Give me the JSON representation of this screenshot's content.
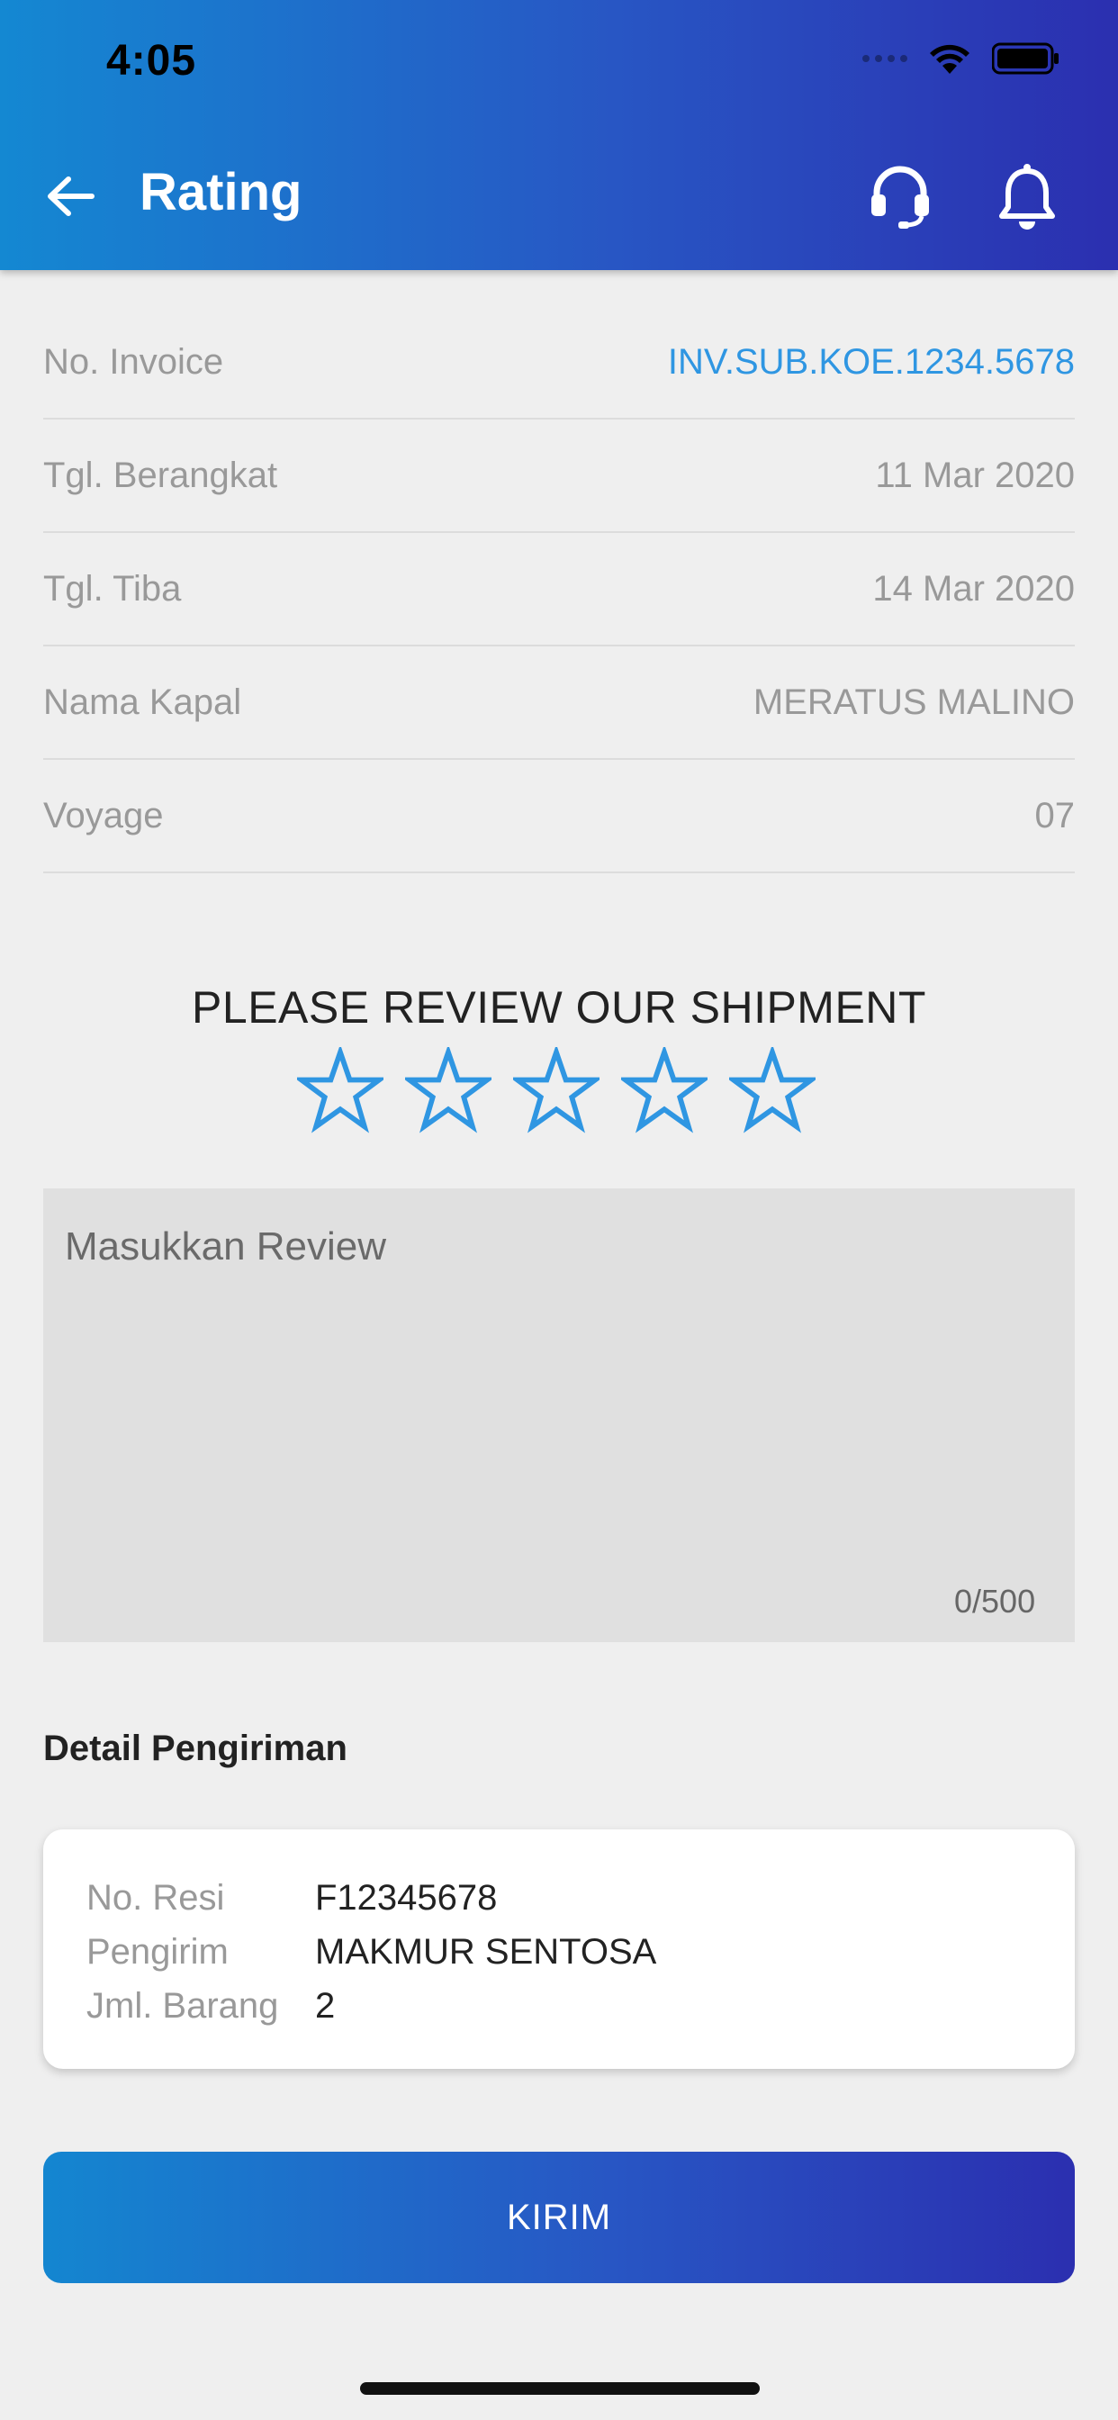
{
  "status_bar": {
    "time": "4:05"
  },
  "header": {
    "title": "Rating"
  },
  "info_rows": [
    {
      "label": "No. Invoice",
      "value": "INV.SUB.KOE.1234.5678"
    },
    {
      "label": "Tgl. Berangkat",
      "value": "11 Mar 2020"
    },
    {
      "label": "Tgl. Tiba",
      "value": "14 Mar 2020"
    },
    {
      "label": "Nama Kapal",
      "value": "MERATUS MALINO"
    },
    {
      "label": "Voyage",
      "value": "07"
    }
  ],
  "review": {
    "heading": "PLEASE REVIEW OUR SHIPMENT",
    "rating": 0,
    "max_rating": 5,
    "placeholder": "Masukkan Review",
    "value": "",
    "char_count": "0/500"
  },
  "detail": {
    "title": "Detail Pengiriman",
    "rows": [
      {
        "label": "No. Resi",
        "value": "F12345678"
      },
      {
        "label": "Pengirim",
        "value": "MAKMUR SENTOSA"
      },
      {
        "label": "Jml. Barang",
        "value": "2"
      }
    ]
  },
  "submit_label": "KIRIM",
  "colors": {
    "accent": "#2f96e2",
    "gradient_start": "#1488d2",
    "gradient_end": "#2b2fb0"
  }
}
